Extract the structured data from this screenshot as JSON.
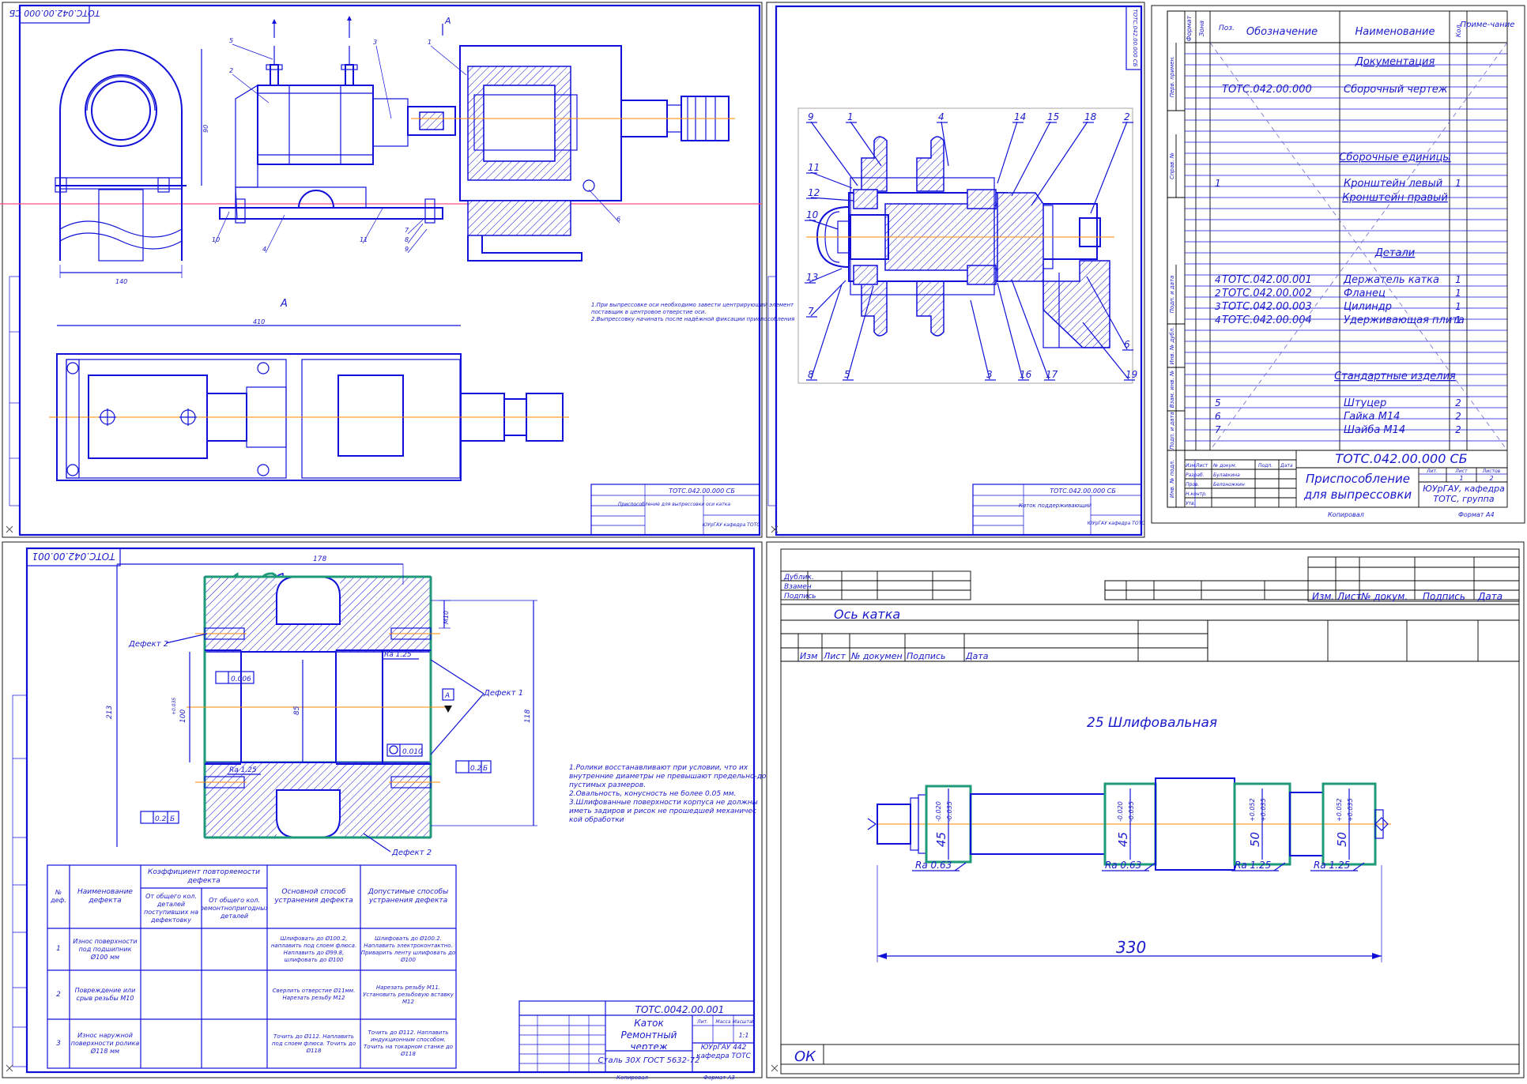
{
  "sheet1": {
    "code_rotated": "ТОТС.042.00.000 СБ",
    "view_label": "А",
    "title_code": "ТОТС.042.00.000 СБ",
    "title_name": "Приспособление для выпрессовки оси катка",
    "title_org": "ЮУрГАУ кафедра ТОТС",
    "notes": [
      "1.При выпрессовке оси необходимо завести центрирующий элемент",
      "поставщик в центровое отверстие оси.",
      "2.Выпрессовку начинать после надёжной фиксации приспособления"
    ],
    "dims": {
      "height": "90",
      "width": "140",
      "length": "410"
    },
    "callouts": [
      "1",
      "2",
      "3",
      "4",
      "5",
      "6",
      "7",
      "8",
      "9",
      "10",
      "11"
    ]
  },
  "sheet2": {
    "code_rotated": "ТОТС.042.00.000 СБ",
    "title_code": "ТОТС.042.00.000 СБ",
    "title_name": "Каток поддерживающий",
    "title_org": "ЮУрГАУ кафедра ТОТС",
    "callouts": [
      "1",
      "2",
      "3",
      "4",
      "5",
      "6",
      "7",
      "8",
      "9",
      "10",
      "11",
      "12",
      "13",
      "14",
      "15",
      "16",
      "17",
      "18",
      "19"
    ]
  },
  "spec": {
    "headers": {
      "format": "Формат",
      "zone": "Зона",
      "pos": "Поз.",
      "designation": "Обозначение",
      "name": "Наименование",
      "qty": "Кол.",
      "note": "Приме-чание"
    },
    "rows": [
      {
        "pos": "",
        "code": "",
        "name": "Документация",
        "qty": ""
      },
      {
        "pos": "",
        "code": "ТОТС.042.00.000",
        "name": "Сборочный чертеж",
        "qty": ""
      },
      {
        "pos": "",
        "code": "",
        "name": "Сборочные единицы",
        "qty": ""
      },
      {
        "pos": "1",
        "code": "",
        "name": "Кронштейн левый",
        "qty": "1"
      },
      {
        "pos": "",
        "code": "",
        "name": "Кронштейн правый",
        "qty": ""
      },
      {
        "pos": "",
        "code": "",
        "name": "Детали",
        "qty": ""
      },
      {
        "pos": "4",
        "code": "ТОТС.042.00.001",
        "name": "Держатель катка",
        "qty": "1"
      },
      {
        "pos": "2",
        "code": "ТОТС.042.00.002",
        "name": "Фланец",
        "qty": "1"
      },
      {
        "pos": "3",
        "code": "ТОТС.042.00.003",
        "name": "Цилиндр",
        "qty": "1"
      },
      {
        "pos": "4",
        "code": "ТОТС.042.00.004",
        "name": "Удерживающая плита",
        "qty": "1"
      },
      {
        "pos": "",
        "code": "",
        "name": "Стандартные изделия",
        "qty": ""
      },
      {
        "pos": "5",
        "code": "",
        "name": "Штуцер",
        "qty": "2"
      },
      {
        "pos": "6",
        "code": "",
        "name": "Гайка М14",
        "qty": "2"
      },
      {
        "pos": "7",
        "code": "",
        "name": "Шайба М14",
        "qty": "2"
      }
    ],
    "side_labels": [
      "Перв. примен.",
      "Справ. №",
      "Подп. и дата",
      "Инв. № дубл.",
      "Взам. инв. №",
      "Подп. и дата",
      "Инв. № подл."
    ],
    "title_code": "ТОТС.042.00.000 СБ",
    "title_name": "Приспособление для выпрессовки оси катка",
    "title_org": "ЮУрГАУ, кафедра ТОТС, группа",
    "lit": "Лит.",
    "sheet": "Лист",
    "sheets": "Листов",
    "sheet_no": "1",
    "sheets_no": "2",
    "stamp_cols": [
      "Изм",
      "Лист",
      "№ докум.",
      "Подп.",
      "Дата"
    ],
    "stamp_roles": [
      "Разраб.",
      "Пров.",
      "Н.контр.",
      "Утв."
    ],
    "stamp_names": [
      "Булавкина",
      "Белоножкин"
    ],
    "copied": "Копировал",
    "format": "Формат  А4"
  },
  "sheet3": {
    "code_rotated": "ТОТС.042.00.001",
    "dims": {
      "width": "178",
      "height": "213",
      "d100": "100",
      "d85": "85",
      "d118": "118",
      "m10": "М10"
    },
    "tol_d100": "+0.035",
    "defects": [
      "Дефект 2",
      "Дефект 1",
      "Дефект 2"
    ],
    "roughness": [
      "Ra 1.25",
      "Ra 1.25"
    ],
    "datum": "А",
    "tolerances": [
      "0.006",
      "0.010",
      "0.2",
      "0.2"
    ],
    "datum_refs": [
      "Б",
      "Б"
    ],
    "notes": [
      "1.Ролики восстанавливают при условии, что их",
      "внутренние диаметры не превышают предельно-до",
      "пустимых размеров.",
      "2.Овальность, конусность не более 0.05 мм.",
      "3.Шлифованные поверхности корпуса не должны",
      "иметь задиров и рисок не прошедшей механичес",
      "кой обработки"
    ],
    "defect_table": {
      "header_no": "№ деф.",
      "header_name": "Наименование дефекта",
      "header_coef": "Коэффициент повторяемости дефекта",
      "sub_total": "От общего кол. деталей поступивших на дефектовку",
      "sub_repair": "От общего кол. ремонтнопригодных деталей",
      "header_method": "Основной способ устранения дефекта",
      "header_alt": "Допустимые способы устранения дефекта",
      "rows": [
        {
          "no": "1",
          "name": "Износ поверхности под подшипник Ø100 мм",
          "method": "Шлифовать до Ø100.2, наплавить под слоем флюса. Наплавить до Ø99.8, шлифовать до Ø100",
          "alt": "Шлифовать до Ø100.2. Наплавить электроконтактно. Приварить ленту шлифовать до Ø100"
        },
        {
          "no": "2",
          "name": "Повреждение или срыв резьбы М10",
          "method": "Сверлить отверстие Ø11мм. Нарезать резьбу М12",
          "alt": "Нарезать резьбу М11. Установить резьбовую вставку М12"
        },
        {
          "no": "3",
          "name": "Износ наружной поверхности ролика Ø118 мм",
          "method": "Точить до Ø112. Наплавить под слоем флюса. Точить до Ø118",
          "alt": "Точить до Ø112. Наплавить индукционным способом. Точить на токарном станке до Ø118"
        }
      ]
    },
    "title_code": "ТОТС.0042.00.001",
    "title_name": "Каток Ремонтный чертеж",
    "material": "Сталь 30Х ГОСТ 5632-72",
    "org": "ЮУрГАУ 442 кафедра ТОТС",
    "scale_hdr": [
      "Лит.",
      "Масса",
      "Масштаб"
    ],
    "scale_val": "1:1",
    "copied": "Копировал",
    "format": "Формат  А3"
  },
  "sheet4": {
    "rows_left": [
      "Дублик.",
      "Взамен",
      "Подпись"
    ],
    "stamp_cols": [
      "Изм.",
      "Лист",
      "№ докум.",
      "Подпись",
      "Дата"
    ],
    "stamp_cols2": [
      "Изм",
      "Лист",
      "№ докумен",
      "Подпись",
      "Дата"
    ],
    "part_name": "Ось катка",
    "operation": "25 Шлифовальная",
    "d1_base": "45",
    "d1_tol": [
      "-0.020",
      "-0.035"
    ],
    "d2_base": "45",
    "d2_tol": [
      "-0.020",
      "-0.035"
    ],
    "d3_base": "50",
    "d3_tol": [
      "+0.052",
      "+0.035"
    ],
    "d4_base": "50",
    "d4_tol": [
      "+0.052",
      "+0.035"
    ],
    "roughness": [
      "Ra 0.63",
      "Ra 0.63",
      "Ra 1.25",
      "Ra 1.25"
    ],
    "length": "330",
    "ok": "ОК"
  }
}
